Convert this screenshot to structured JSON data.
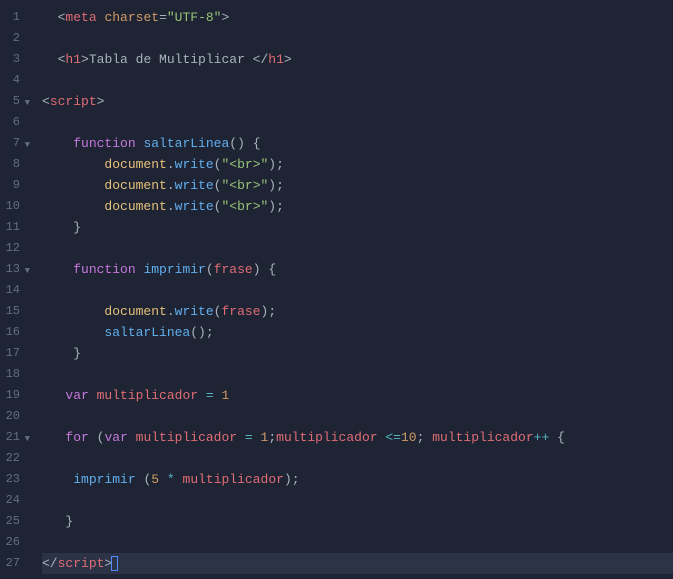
{
  "lines": [
    {
      "num": "1",
      "fold": "",
      "tokens": [
        {
          "t": "  ",
          "c": "txt"
        },
        {
          "t": "<",
          "c": "tag-br"
        },
        {
          "t": "meta",
          "c": "tag"
        },
        {
          "t": " ",
          "c": "txt"
        },
        {
          "t": "charset",
          "c": "attr"
        },
        {
          "t": "=",
          "c": "op-eq"
        },
        {
          "t": "\"UTF-8\"",
          "c": "str"
        },
        {
          "t": ">",
          "c": "tag-br"
        }
      ]
    },
    {
      "num": "2",
      "fold": "",
      "tokens": []
    },
    {
      "num": "3",
      "fold": "",
      "tokens": [
        {
          "t": "  ",
          "c": "txt"
        },
        {
          "t": "<",
          "c": "tag-br"
        },
        {
          "t": "h1",
          "c": "tag"
        },
        {
          "t": ">",
          "c": "tag-br"
        },
        {
          "t": "Tabla de Multiplicar ",
          "c": "txt"
        },
        {
          "t": "</",
          "c": "tag-br"
        },
        {
          "t": "h1",
          "c": "tag"
        },
        {
          "t": ">",
          "c": "tag-br"
        }
      ]
    },
    {
      "num": "4",
      "fold": "",
      "tokens": []
    },
    {
      "num": "5",
      "fold": "▼",
      "tokens": [
        {
          "t": "<",
          "c": "tag-br"
        },
        {
          "t": "script",
          "c": "tag"
        },
        {
          "t": ">",
          "c": "tag-br"
        }
      ]
    },
    {
      "num": "6",
      "fold": "",
      "tokens": []
    },
    {
      "num": "7",
      "fold": "▼",
      "tokens": [
        {
          "t": "    ",
          "c": "txt"
        },
        {
          "t": "function",
          "c": "kw"
        },
        {
          "t": " ",
          "c": "txt"
        },
        {
          "t": "saltarLinea",
          "c": "fn-name"
        },
        {
          "t": "()",
          "c": "paren"
        },
        {
          "t": " ",
          "c": "txt"
        },
        {
          "t": "{",
          "c": "brace"
        }
      ]
    },
    {
      "num": "8",
      "fold": "",
      "tokens": [
        {
          "t": "        ",
          "c": "txt"
        },
        {
          "t": "document",
          "c": "obj"
        },
        {
          "t": ".",
          "c": "dot"
        },
        {
          "t": "write",
          "c": "method"
        },
        {
          "t": "(",
          "c": "paren"
        },
        {
          "t": "\"<br>\"",
          "c": "str"
        },
        {
          "t": ")",
          "c": "paren"
        },
        {
          "t": ";",
          "c": "semi"
        }
      ]
    },
    {
      "num": "9",
      "fold": "",
      "tokens": [
        {
          "t": "        ",
          "c": "txt"
        },
        {
          "t": "document",
          "c": "obj"
        },
        {
          "t": ".",
          "c": "dot"
        },
        {
          "t": "write",
          "c": "method"
        },
        {
          "t": "(",
          "c": "paren"
        },
        {
          "t": "\"<br>\"",
          "c": "str"
        },
        {
          "t": ")",
          "c": "paren"
        },
        {
          "t": ";",
          "c": "semi"
        }
      ]
    },
    {
      "num": "10",
      "fold": "",
      "tokens": [
        {
          "t": "        ",
          "c": "txt"
        },
        {
          "t": "document",
          "c": "obj"
        },
        {
          "t": ".",
          "c": "dot"
        },
        {
          "t": "write",
          "c": "method"
        },
        {
          "t": "(",
          "c": "paren"
        },
        {
          "t": "\"<br>\"",
          "c": "str"
        },
        {
          "t": ")",
          "c": "paren"
        },
        {
          "t": ";",
          "c": "semi"
        }
      ]
    },
    {
      "num": "11",
      "fold": "",
      "tokens": [
        {
          "t": "    ",
          "c": "txt"
        },
        {
          "t": "}",
          "c": "brace"
        }
      ]
    },
    {
      "num": "12",
      "fold": "",
      "tokens": []
    },
    {
      "num": "13",
      "fold": "▼",
      "tokens": [
        {
          "t": "    ",
          "c": "txt"
        },
        {
          "t": "function",
          "c": "kw"
        },
        {
          "t": " ",
          "c": "txt"
        },
        {
          "t": "imprimir",
          "c": "fn-name"
        },
        {
          "t": "(",
          "c": "paren"
        },
        {
          "t": "frase",
          "c": "ident"
        },
        {
          "t": ")",
          "c": "paren"
        },
        {
          "t": " ",
          "c": "txt"
        },
        {
          "t": "{",
          "c": "brace"
        }
      ]
    },
    {
      "num": "14",
      "fold": "",
      "tokens": []
    },
    {
      "num": "15",
      "fold": "",
      "tokens": [
        {
          "t": "        ",
          "c": "txt"
        },
        {
          "t": "document",
          "c": "obj"
        },
        {
          "t": ".",
          "c": "dot"
        },
        {
          "t": "write",
          "c": "method"
        },
        {
          "t": "(",
          "c": "paren"
        },
        {
          "t": "frase",
          "c": "ident"
        },
        {
          "t": ")",
          "c": "paren"
        },
        {
          "t": ";",
          "c": "semi"
        }
      ]
    },
    {
      "num": "16",
      "fold": "",
      "tokens": [
        {
          "t": "        ",
          "c": "txt"
        },
        {
          "t": "saltarLinea",
          "c": "fn-name"
        },
        {
          "t": "()",
          "c": "paren"
        },
        {
          "t": ";",
          "c": "semi"
        }
      ]
    },
    {
      "num": "17",
      "fold": "",
      "tokens": [
        {
          "t": "    ",
          "c": "txt"
        },
        {
          "t": "}",
          "c": "brace"
        }
      ]
    },
    {
      "num": "18",
      "fold": "",
      "tokens": []
    },
    {
      "num": "19",
      "fold": "",
      "tokens": [
        {
          "t": "   ",
          "c": "txt"
        },
        {
          "t": "var",
          "c": "kw"
        },
        {
          "t": " ",
          "c": "txt"
        },
        {
          "t": "multiplicador",
          "c": "ident"
        },
        {
          "t": " ",
          "c": "txt"
        },
        {
          "t": "=",
          "c": "op"
        },
        {
          "t": " ",
          "c": "txt"
        },
        {
          "t": "1",
          "c": "num"
        }
      ]
    },
    {
      "num": "20",
      "fold": "",
      "tokens": []
    },
    {
      "num": "21",
      "fold": "▼",
      "tokens": [
        {
          "t": "   ",
          "c": "txt"
        },
        {
          "t": "for",
          "c": "kw"
        },
        {
          "t": " ",
          "c": "txt"
        },
        {
          "t": "(",
          "c": "paren"
        },
        {
          "t": "var",
          "c": "kw"
        },
        {
          "t": " ",
          "c": "txt"
        },
        {
          "t": "multiplicador",
          "c": "ident"
        },
        {
          "t": " ",
          "c": "txt"
        },
        {
          "t": "=",
          "c": "op"
        },
        {
          "t": " ",
          "c": "txt"
        },
        {
          "t": "1",
          "c": "num"
        },
        {
          "t": ";",
          "c": "semi"
        },
        {
          "t": "multiplicador",
          "c": "ident"
        },
        {
          "t": " ",
          "c": "txt"
        },
        {
          "t": "<=",
          "c": "op"
        },
        {
          "t": "10",
          "c": "num"
        },
        {
          "t": ";",
          "c": "semi"
        },
        {
          "t": " ",
          "c": "txt"
        },
        {
          "t": "multiplicador",
          "c": "ident"
        },
        {
          "t": "++",
          "c": "op"
        },
        {
          "t": " ",
          "c": "txt"
        },
        {
          "t": "{",
          "c": "brace"
        }
      ]
    },
    {
      "num": "22",
      "fold": "",
      "tokens": []
    },
    {
      "num": "23",
      "fold": "",
      "tokens": [
        {
          "t": "    ",
          "c": "txt"
        },
        {
          "t": "imprimir",
          "c": "fn-name"
        },
        {
          "t": " ",
          "c": "txt"
        },
        {
          "t": "(",
          "c": "paren"
        },
        {
          "t": "5",
          "c": "num"
        },
        {
          "t": " ",
          "c": "txt"
        },
        {
          "t": "*",
          "c": "op"
        },
        {
          "t": " ",
          "c": "txt"
        },
        {
          "t": "multiplicador",
          "c": "ident"
        },
        {
          "t": ")",
          "c": "paren"
        },
        {
          "t": ";",
          "c": "semi"
        }
      ]
    },
    {
      "num": "24",
      "fold": "",
      "tokens": []
    },
    {
      "num": "25",
      "fold": "",
      "tokens": [
        {
          "t": "   ",
          "c": "txt"
        },
        {
          "t": "}",
          "c": "brace"
        }
      ]
    },
    {
      "num": "26",
      "fold": "",
      "tokens": []
    },
    {
      "num": "27",
      "fold": "",
      "hl": true,
      "cursor": true,
      "tokens": [
        {
          "t": "</",
          "c": "tag-br"
        },
        {
          "t": "script",
          "c": "tag"
        },
        {
          "t": ">",
          "c": "tag-br"
        }
      ]
    }
  ]
}
